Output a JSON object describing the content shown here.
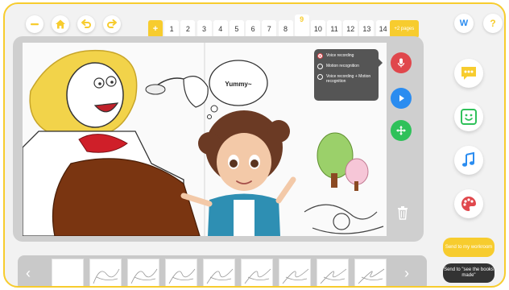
{
  "top_bar": {
    "icons": [
      "minus-icon",
      "home-icon",
      "undo-icon",
      "redo-icon"
    ],
    "add_page_label": "+",
    "pages": [
      "1",
      "2",
      "3",
      "4",
      "5",
      "6",
      "7",
      "8",
      "9",
      "10",
      "11",
      "12",
      "13",
      "14"
    ],
    "current_page": "9",
    "add_pages_label": "+2 pages",
    "logo_letter": "W",
    "help_label": "?"
  },
  "canvas": {
    "speech_bubble_text": "Yummy~",
    "record_popup": {
      "options": [
        "Voice recording",
        "Motion recognition",
        "Voice recording + Motion recognition"
      ],
      "selected_index": 0
    },
    "tools": [
      "microphone-icon",
      "play-icon",
      "move-icon"
    ],
    "trash_icon": "trash-icon"
  },
  "right_panel": {
    "icons": [
      "speech-bubble-icon",
      "sticker-face-icon",
      "music-note-icon",
      "palette-icon"
    ],
    "send_workroom_label": "Send to my workroom",
    "send_books_label": "Send to \"see the books made\""
  },
  "thumbnails": {
    "count": 9,
    "prev_label": "‹",
    "next_label": "›"
  },
  "colors": {
    "accent_yellow": "#f7cc2e",
    "record_red": "#e0474c",
    "play_blue": "#2a8cf0",
    "move_green": "#2fc15a"
  }
}
